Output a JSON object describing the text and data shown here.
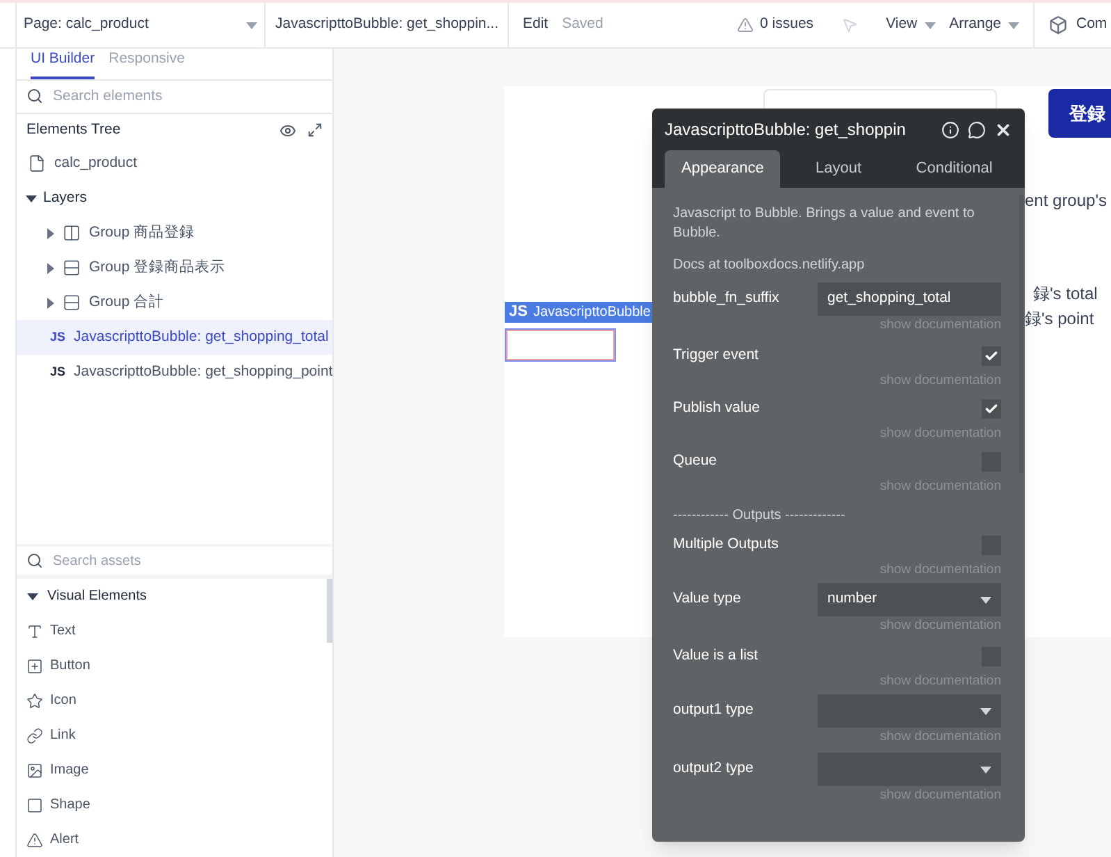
{
  "top_bar": {
    "page_selector": "Page: calc_product",
    "element_selector": "JavascripttoBubble: get_shoppin...",
    "edit": "Edit",
    "saved": "Saved",
    "issues": "0 issues",
    "menus": [
      "View",
      "Arrange"
    ],
    "components": "Com"
  },
  "left_panel": {
    "tabs": [
      {
        "label": "UI Builder",
        "selected": true
      },
      {
        "label": "Responsive",
        "selected": false
      }
    ],
    "search": {
      "placeholder": "Search elements"
    },
    "tree_title": "Elements Tree",
    "tree": [
      {
        "label": "calc_product",
        "kind": "page",
        "selected": false
      },
      {
        "label": "Layers",
        "kind": "folder",
        "expanded": true,
        "selected": false,
        "children": [
          {
            "label": "Group 商品登録",
            "kind": "column-group",
            "expanded": false,
            "selected": false
          },
          {
            "label": "Group 登録商品表示",
            "kind": "row-group",
            "expanded": false,
            "selected": false
          },
          {
            "label": "Group 合計",
            "kind": "row-group",
            "expanded": false,
            "selected": false
          },
          {
            "label": "JavascripttoBubble: get_shopping_total",
            "kind": "js",
            "badge": "JS",
            "selected": true
          },
          {
            "label": "JavascripttoBubble: get_shopping_point",
            "kind": "js",
            "badge": "JS",
            "selected": false
          }
        ]
      }
    ],
    "assets_search": {
      "placeholder": "Search assets"
    },
    "assets_section": {
      "label": "Visual Elements",
      "expanded": true,
      "items": [
        {
          "label": "Text",
          "kind": "text"
        },
        {
          "label": "Button",
          "kind": "button"
        },
        {
          "label": "Icon",
          "kind": "icon"
        },
        {
          "label": "Link",
          "kind": "link"
        },
        {
          "label": "Image",
          "kind": "image"
        },
        {
          "label": "Shape",
          "kind": "shape"
        },
        {
          "label": "Alert",
          "kind": "alert"
        }
      ]
    }
  },
  "canvas": {
    "button": "登録",
    "texts": [
      "ent group's",
      "録's total",
      "録's point"
    ],
    "js_tag": {
      "badge": "JS",
      "label": "JavascripttoBubble:"
    }
  },
  "popup": {
    "title": "JavascripttoBubble: get_shoppin",
    "tabs": [
      {
        "label": "Appearance",
        "selected": true
      },
      {
        "label": "Layout",
        "selected": false
      },
      {
        "label": "Conditional",
        "selected": false
      }
    ],
    "description": "Javascript to Bubble. Brings a value and event to Bubble.",
    "docs": "Docs at toolboxdocs.netlify.app",
    "fields": [
      {
        "kind": "text",
        "label": "bubble_fn_suffix",
        "value": "get_shopping_total",
        "doc": "show documentation"
      },
      {
        "kind": "checkbox",
        "label": "Trigger event",
        "checked": true,
        "doc": "show documentation"
      },
      {
        "kind": "checkbox",
        "label": "Publish value",
        "checked": true,
        "doc": "show documentation"
      },
      {
        "kind": "checkbox",
        "label": "Queue",
        "checked": false,
        "doc": "show documentation"
      },
      {
        "kind": "separator",
        "label": "------------ Outputs -------------"
      },
      {
        "kind": "checkbox",
        "label": "Multiple Outputs",
        "checked": false,
        "doc": "show documentation"
      },
      {
        "kind": "dropdown",
        "label": "Value type",
        "value": "number",
        "doc": "show documentation"
      },
      {
        "kind": "checkbox",
        "label": "Value is a list",
        "checked": false,
        "doc": "show documentation"
      },
      {
        "kind": "dropdown",
        "label": "output1 type",
        "doc": "show documentation"
      },
      {
        "kind": "dropdown",
        "label": "output2 type",
        "doc": "show documentation"
      }
    ]
  }
}
